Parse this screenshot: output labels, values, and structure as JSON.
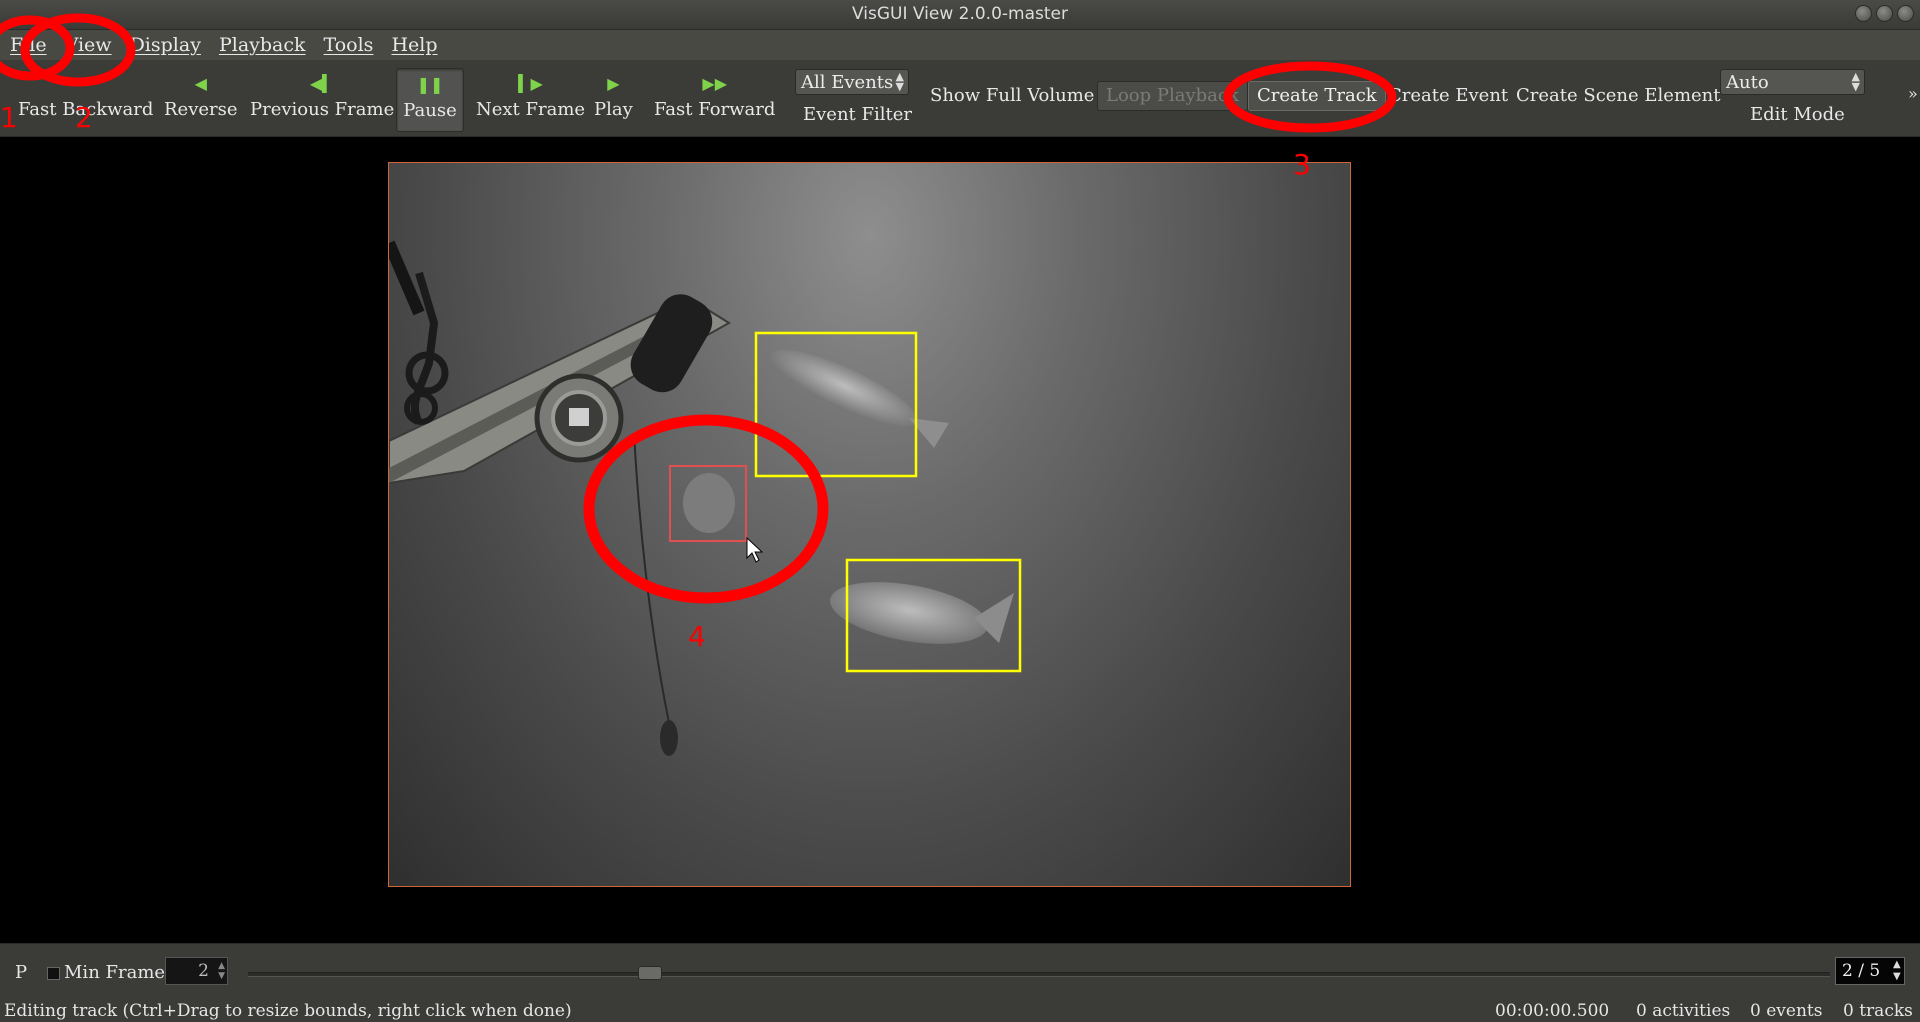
{
  "window": {
    "title": "VisGUI View 2.0.0-master"
  },
  "menubar": {
    "items": [
      "File",
      "View",
      "Display",
      "Playback",
      "Tools",
      "Help"
    ]
  },
  "toolbar": {
    "playback_buttons": [
      {
        "label": "Fast Backward",
        "icon": "fast-backward-icon",
        "glyph": ""
      },
      {
        "label": "Reverse",
        "icon": "reverse-icon",
        "glyph": "◀"
      },
      {
        "label": "Previous Frame",
        "icon": "previous-frame-icon",
        "glyph": "◀▍"
      },
      {
        "label": "Pause",
        "icon": "pause-icon",
        "glyph": "❚❚",
        "pressed": true
      },
      {
        "label": "Next Frame",
        "icon": "next-frame-icon",
        "glyph": "▍▶"
      },
      {
        "label": "Play",
        "icon": "play-icon",
        "glyph": "▶"
      },
      {
        "label": "Fast Forward",
        "icon": "fast-forward-icon",
        "glyph": "▶▶"
      }
    ],
    "event_filter": {
      "value": "All Events",
      "label": "Event Filter"
    },
    "show_full_volume": "Show Full Volume",
    "loop_playback": "Loop Playback",
    "create_track": "Create Track",
    "create_event": "Create Event",
    "create_scene_element": "Create Scene Element",
    "edit_mode": {
      "value": "Auto",
      "label": "Edit Mode"
    },
    "overflow": "»"
  },
  "timeline": {
    "p_label": "P",
    "min_frame_label": "Min Frame",
    "min_frame_value": "2",
    "frame_counter": "2 / 5",
    "slider_position_fraction": 0.254
  },
  "statusbar": {
    "message": "Editing track (Ctrl+Drag to resize bounds, right click when done)",
    "time": "00:00:00.500",
    "activities": "0 activities",
    "events": "0 events",
    "tracks": "0 tracks"
  },
  "annotations": [
    "1",
    "2",
    "3",
    "4"
  ],
  "colors": {
    "annotation_red": "#ff0000",
    "track_box_yellow": "#ffff00",
    "selected_box": "#e05050",
    "play_icon_green": "#7fd34a",
    "viewport_border": "#d0653a"
  }
}
